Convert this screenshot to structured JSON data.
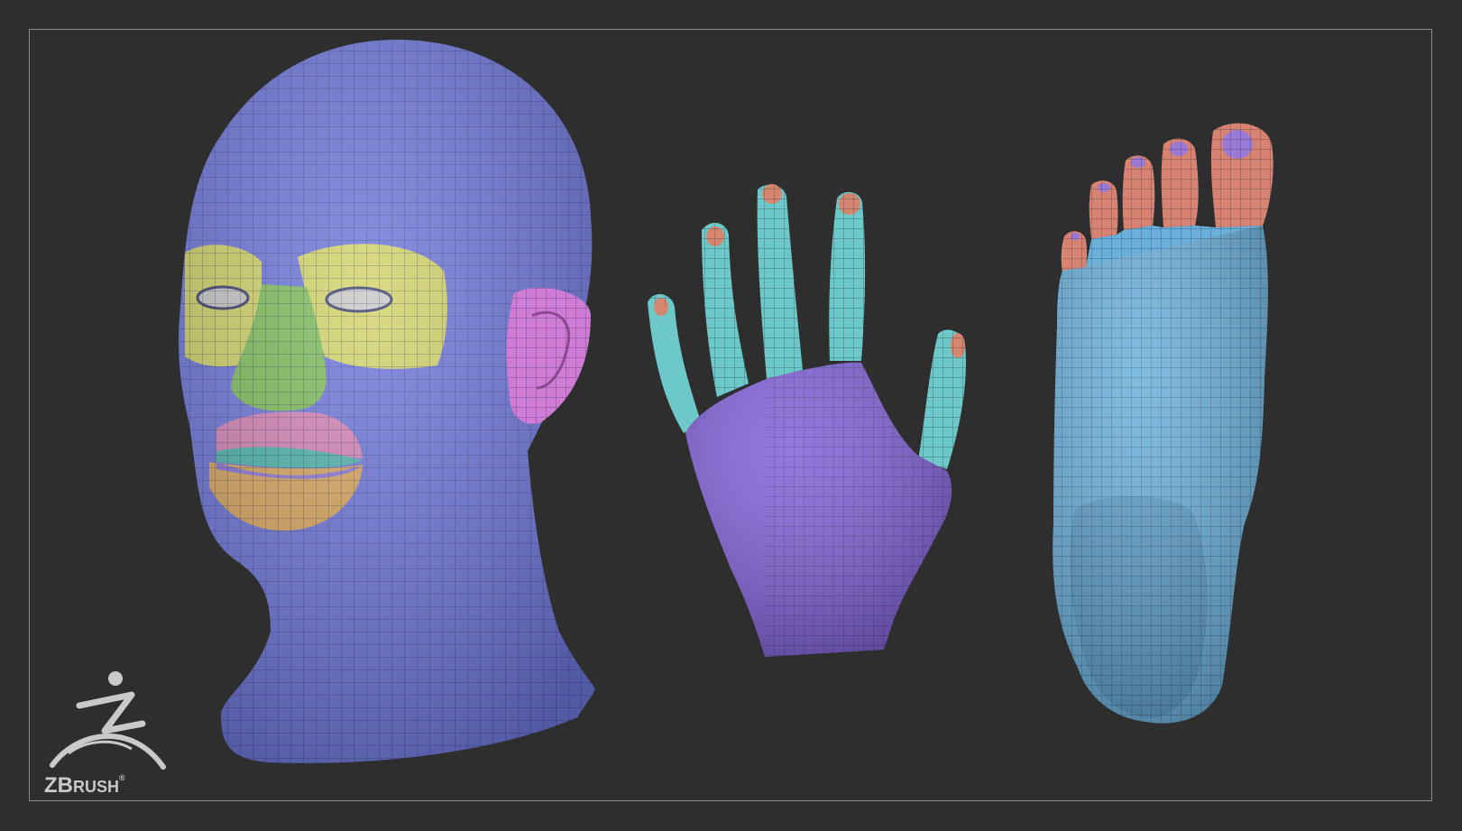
{
  "scene": {
    "background": "#2e2e2e",
    "frame_color": "#8a8a8a",
    "objects": [
      {
        "name": "head",
        "polygroups": {
          "skin": "#6f78dc",
          "eyes": "#d3d46a",
          "nose": "#7fbe5e",
          "ear": "#d07cd6",
          "upper-lip": "#d685b8",
          "lip-line": "#4fb5ad",
          "chin": "#d9a860",
          "eyeball": "#c8c8c8"
        }
      },
      {
        "name": "hand",
        "polygroups": {
          "palm": "#8060d8",
          "fingers": "#6dc9c9",
          "nails": "#d6866e"
        }
      },
      {
        "name": "foot",
        "polygroups": {
          "foot": "#6ab0dc",
          "toes": "#d88272",
          "toenails": "#9a7ad6"
        }
      }
    ]
  },
  "logo": {
    "icon": "zbrush-figure-icon",
    "wordmark_big_1": "Z",
    "wordmark_big_2": "B",
    "wordmark_small": "RUSH",
    "registered": "®",
    "color": "#c9c9c9"
  }
}
